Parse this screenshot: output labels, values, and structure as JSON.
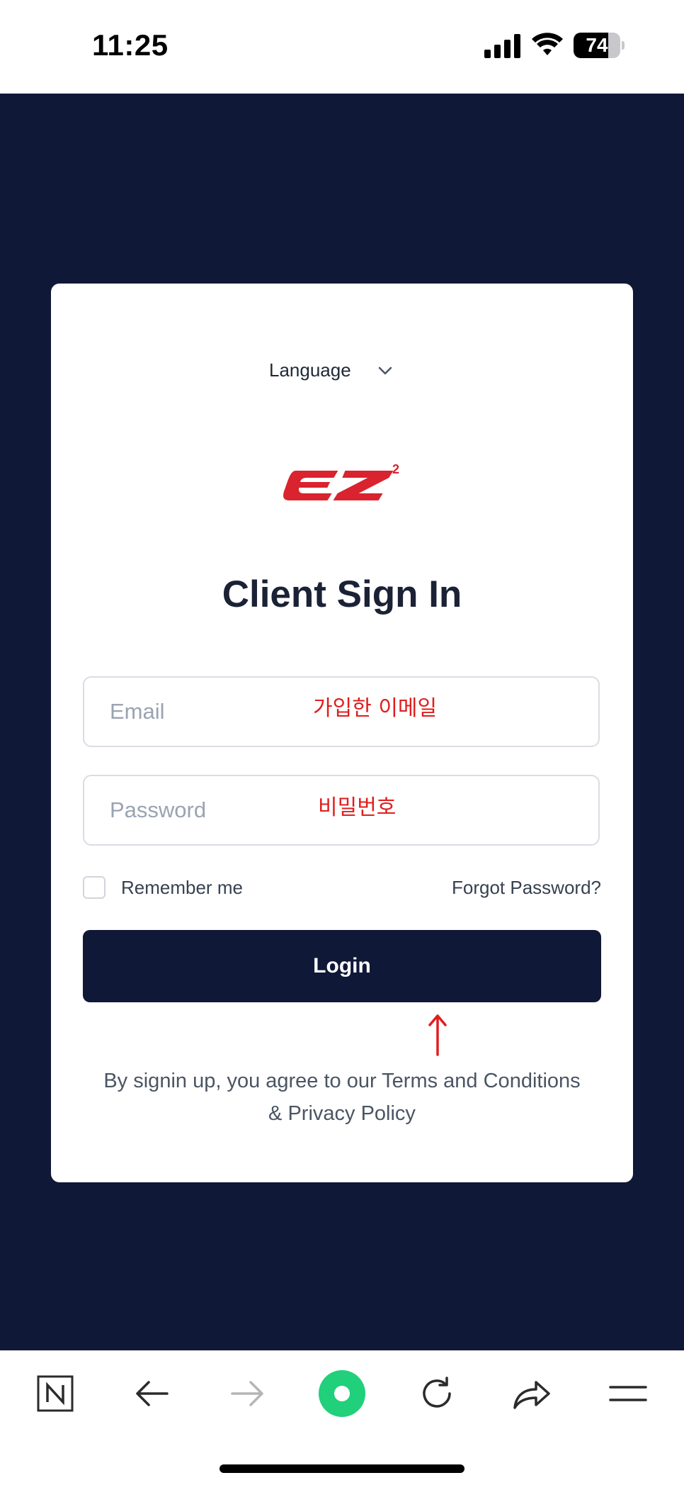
{
  "status_bar": {
    "time": "11:25",
    "battery": "74",
    "battery_level": 0.74,
    "icons": [
      "signal-icon",
      "wifi-icon",
      "battery-icon"
    ]
  },
  "card": {
    "language": {
      "label": "Language",
      "icon": "chevron-down-icon"
    },
    "logo": {
      "text": "EZ",
      "superscript": "2",
      "color": "#d9232e"
    },
    "title": "Client Sign In",
    "email": {
      "placeholder": "Email",
      "value": "",
      "annotation": "가입한 이메일"
    },
    "password": {
      "placeholder": "Password",
      "value": "",
      "annotation": "비밀번호"
    },
    "remember_me": {
      "label": "Remember me",
      "checked": false
    },
    "forgot_password": "Forgot Password?",
    "login_button": "Login",
    "terms_line1": "By signin up, you agree to our Terms and Conditions",
    "terms_line2": "& Privacy Policy"
  },
  "annotations": {
    "arrow": "up-arrow",
    "color": "#e01e1e"
  },
  "colors": {
    "page_background": "#0f1836",
    "button_background": "#0f1836",
    "title_color": "#1b2235",
    "accent_green": "#21d07a"
  },
  "toolbar": {
    "items": [
      "naver-n-icon",
      "back-arrow-icon",
      "forward-arrow-icon",
      "green-dot-icon",
      "refresh-icon",
      "share-icon",
      "menu-icon"
    ]
  }
}
